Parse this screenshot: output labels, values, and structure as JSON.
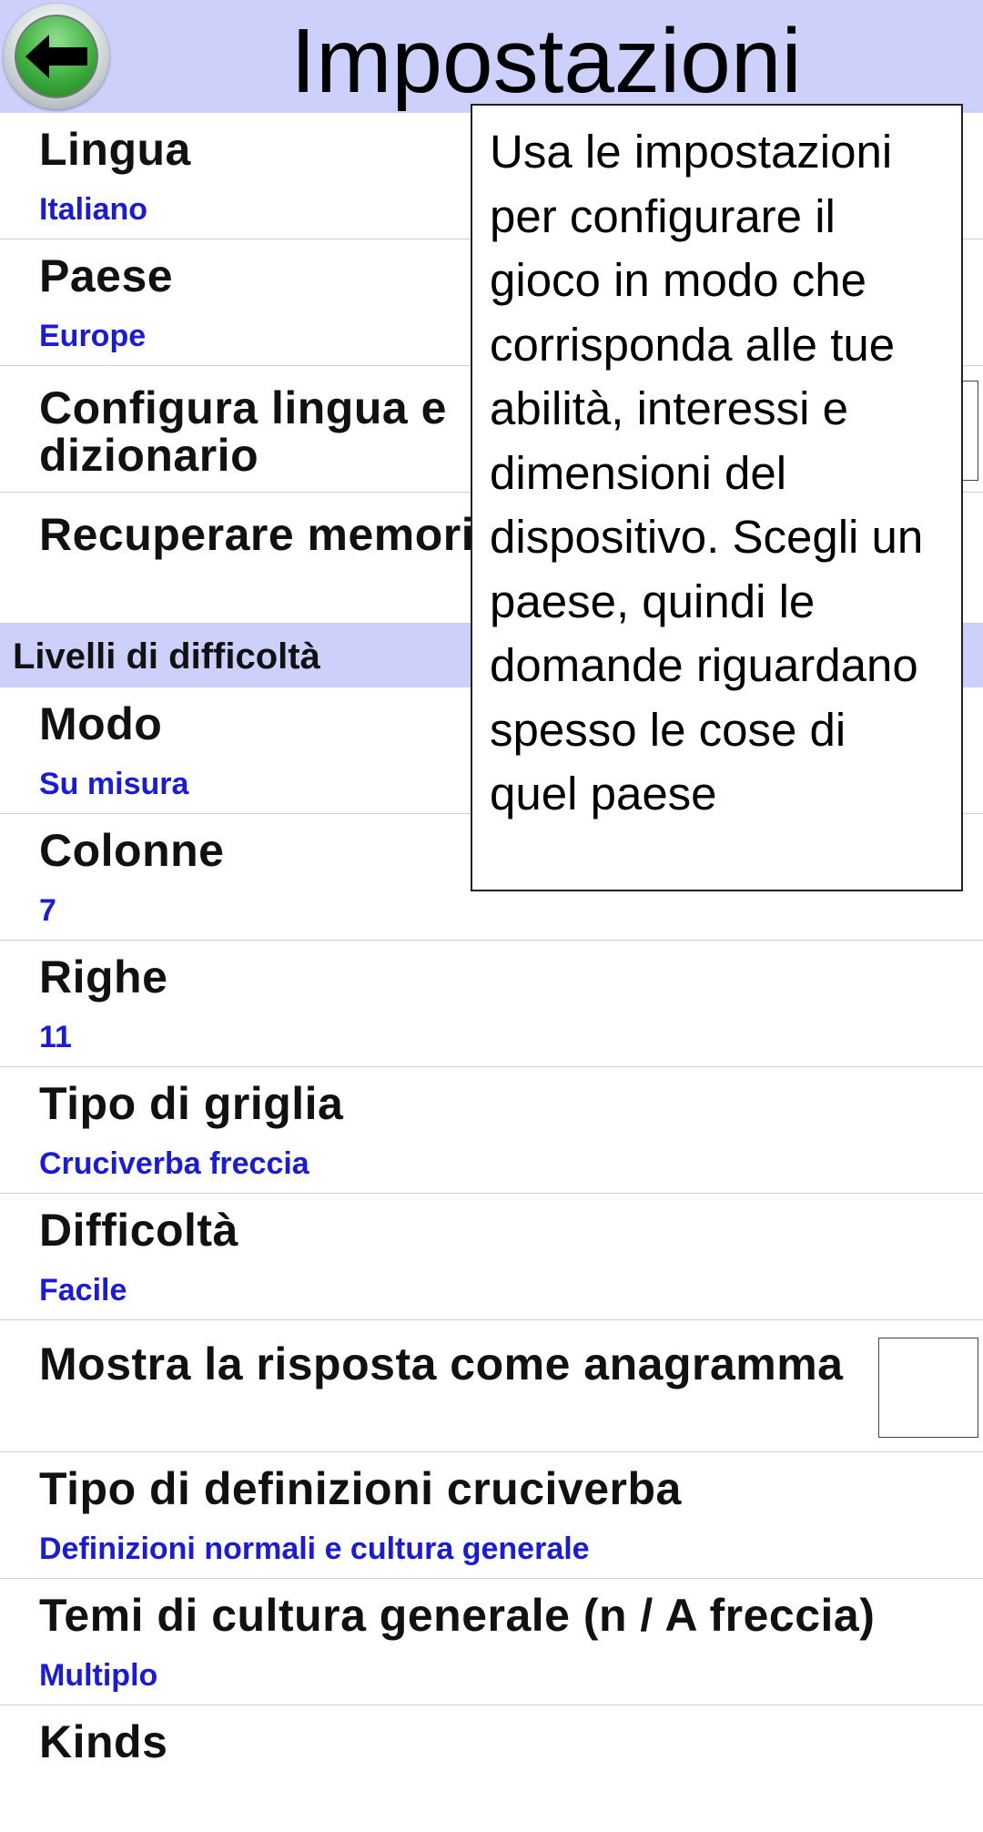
{
  "header": {
    "title": "Impostazioni",
    "back_icon": "back-arrow-icon"
  },
  "settings": [
    {
      "label": "Lingua",
      "value": "Italiano"
    },
    {
      "label": "Paese",
      "value": "Europe"
    },
    {
      "label": "Configura lingua e dizionario separatamente"
    },
    {
      "label": "Recuperare memoria"
    }
  ],
  "section": {
    "title": "Livelli di difficoltà"
  },
  "difficulty": [
    {
      "label": "Modo",
      "value": "Su misura"
    },
    {
      "label": "Colonne",
      "value": "7"
    },
    {
      "label": "Righe",
      "value": "11"
    },
    {
      "label": "Tipo di griglia",
      "value": "Cruciverba freccia"
    },
    {
      "label": "Difficoltà",
      "value": "Facile"
    },
    {
      "label": "Mostra la risposta come anagramma"
    },
    {
      "label": "Tipo di definizioni cruciverba",
      "value": "Definizioni normali e cultura generale"
    },
    {
      "label": "Temi di cultura generale (n / A freccia)",
      "value": "Multiplo"
    },
    {
      "label": "Kinds"
    }
  ],
  "tooltip": {
    "text": "Usa le impostazioni per configurare il gioco in modo che corrisponda alle tue abilità, interessi e dimensioni del dispositivo. Scegli un paese, quindi le domande riguardano spesso le cose di quel paese"
  },
  "colors": {
    "header_bg": "#cdd0fb",
    "value_text": "#1a1adb",
    "back_button": "#3fae3f"
  }
}
